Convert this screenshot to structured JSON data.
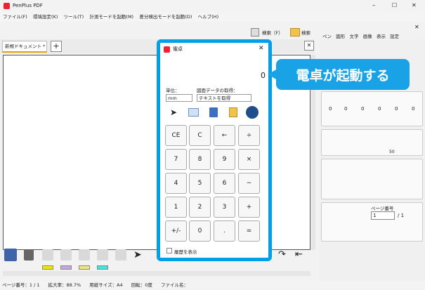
{
  "app": {
    "title": "PenPlus PDF",
    "min": "–",
    "max": "☐",
    "close": "✕"
  },
  "menu": [
    "ファイル(F)",
    "環境設定(K)",
    "ツール(T)",
    "計測モードを起動(M)",
    "差分検出モードを起動(D)",
    "ヘルプ(H)"
  ],
  "search": {
    "label1": "検索（F）",
    "label2": "検索"
  },
  "tab": {
    "name": "新規ドキュメント *",
    "close": "✕",
    "add": "+",
    "panel_close": "✕"
  },
  "calc": {
    "title": "電卓",
    "close": "✕",
    "display": "0",
    "unit_label": "単位：",
    "unit_value": "mm",
    "fetch_label": "図面データの取得：",
    "fetch_value": "テキストを取得",
    "keys": [
      "CE",
      "C",
      "←",
      "÷",
      "7",
      "8",
      "9",
      "×",
      "4",
      "5",
      "6",
      "−",
      "1",
      "2",
      "3",
      "+",
      "+/-",
      "0",
      ".",
      "="
    ],
    "history_label": "履歴を表示"
  },
  "callout": {
    "text": "電卓が起動する"
  },
  "right": {
    "tabs": [
      "ペン",
      "図形",
      "文字",
      "画像",
      "表示",
      "設定"
    ],
    "zeros": [
      "0",
      "0",
      "0",
      "0",
      "0",
      "0"
    ],
    "size": "50",
    "page_label": "ページ番号",
    "page_value": "1",
    "page_total": "/ 1",
    "close": "✕"
  },
  "status": {
    "page": "ページ番号：1 / 1",
    "zoom": "拡大率：88.7%",
    "paper": "用紙サイズ：A4",
    "rotation": "回転：0度",
    "file": "ファイル名："
  },
  "colors": {
    "accent": "#00a0e8",
    "marker1": "#f5e400",
    "marker2": "#c8a6e6",
    "marker3": "#f2e87a",
    "marker4": "#3de6e6"
  }
}
